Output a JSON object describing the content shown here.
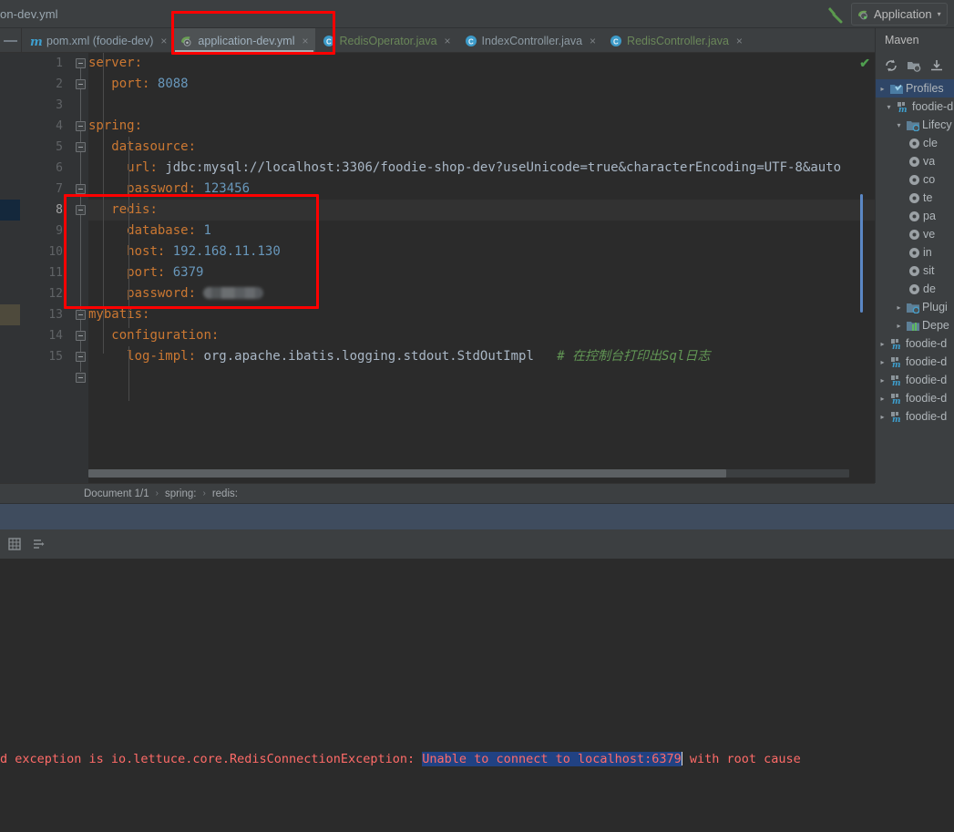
{
  "window": {
    "nav_breadcrumb": "on-dev.yml",
    "run_config": "Application",
    "run_config_arrow": "▾",
    "minimize_label": "—"
  },
  "tabs": [
    {
      "label": "pom.xml (foodie-dev)",
      "icon": "maven-m-icon",
      "close": "×",
      "active": false,
      "color": "#4f9cc4"
    },
    {
      "label": "application-dev.yml",
      "icon": "spring-leaf-icon",
      "close": "×",
      "active": true,
      "color": "#9aa7b0"
    },
    {
      "label": "RedisOperator.java",
      "icon": "java-class-icon",
      "close": "×",
      "active": false,
      "color": "#6a8759"
    },
    {
      "label": "IndexController.java",
      "icon": "java-class-icon",
      "close": "×",
      "active": false,
      "color": "#8d9aa3"
    },
    {
      "label": "RedisController.java",
      "icon": "java-class-icon",
      "close": "×",
      "active": false,
      "color": "#6a8759"
    }
  ],
  "editor": {
    "file": "application-dev.yml",
    "current_line": 8,
    "line_numbers": [
      "1",
      "2",
      "3",
      "4",
      "5",
      "6",
      "7",
      "8",
      "9",
      "10",
      "11",
      "12",
      "13",
      "14",
      "15"
    ],
    "lines": [
      {
        "n": "1",
        "indent": 0,
        "key": "server:",
        "value": "",
        "type": "key"
      },
      {
        "n": "2",
        "indent": 1,
        "key": "port:",
        "value": "8088",
        "type": "num"
      },
      {
        "n": "3",
        "indent": 0,
        "key": "",
        "value": "",
        "type": "blank"
      },
      {
        "n": "4",
        "indent": 0,
        "key": "spring:",
        "value": "",
        "type": "key"
      },
      {
        "n": "5",
        "indent": 1,
        "key": "datasource:",
        "value": "",
        "type": "key"
      },
      {
        "n": "6",
        "indent": 2,
        "key": "url:",
        "value": "jdbc:mysql://localhost:3306/foodie-shop-dev?useUnicode=true&characterEncoding=UTF-8&auto",
        "type": "str"
      },
      {
        "n": "7",
        "indent": 2,
        "key": "password:",
        "value": "123456",
        "type": "num"
      },
      {
        "n": "8",
        "indent": 1,
        "key": "redis:",
        "value": "",
        "type": "key"
      },
      {
        "n": "9",
        "indent": 2,
        "key": "database:",
        "value": "1",
        "type": "num"
      },
      {
        "n": "10",
        "indent": 2,
        "key": "host:",
        "value": "192.168.11.130",
        "type": "num"
      },
      {
        "n": "11",
        "indent": 2,
        "key": "port:",
        "value": "6379",
        "type": "num"
      },
      {
        "n": "12",
        "indent": 2,
        "key": "password:",
        "value": "",
        "type": "masked"
      },
      {
        "n": "13",
        "indent": 0,
        "key": "mybatis:",
        "value": "",
        "type": "key"
      },
      {
        "n": "14",
        "indent": 1,
        "key": "configuration:",
        "value": "",
        "type": "key"
      },
      {
        "n": "15",
        "indent": 2,
        "key": "log-impl:",
        "value": "org.apache.ibatis.logging.stdout.StdOutImpl",
        "comment": "# 在控制台打印出Sql日志",
        "type": "str"
      }
    ],
    "inspection_status": "✔"
  },
  "breadcrumb": {
    "document": "Document 1/1",
    "sep": "›",
    "path": [
      "spring:",
      "redis:"
    ]
  },
  "maven": {
    "title": "Maven",
    "toolbar": [
      "reload-icon",
      "add-folder-icon",
      "download-sources-icon"
    ],
    "tree": [
      {
        "label": "Profiles",
        "indent": 0,
        "twist": "▸",
        "icon": "profiles-folder-icon",
        "selected": true
      },
      {
        "label": "foodie-d",
        "indent": 1,
        "twist": "▾",
        "icon": "maven-module-icon",
        "selected": false
      },
      {
        "label": "Lifecy",
        "indent": 2,
        "twist": "▾",
        "icon": "lifecycle-folder-icon",
        "selected": false
      },
      {
        "label": "cle",
        "indent": 3,
        "twist": "",
        "icon": "gear-icon",
        "selected": false
      },
      {
        "label": "va",
        "indent": 3,
        "twist": "",
        "icon": "gear-icon",
        "selected": false
      },
      {
        "label": "co",
        "indent": 3,
        "twist": "",
        "icon": "gear-icon",
        "selected": false
      },
      {
        "label": "te",
        "indent": 3,
        "twist": "",
        "icon": "gear-icon",
        "selected": false
      },
      {
        "label": "pa",
        "indent": 3,
        "twist": "",
        "icon": "gear-icon",
        "selected": false
      },
      {
        "label": "ve",
        "indent": 3,
        "twist": "",
        "icon": "gear-icon",
        "selected": false
      },
      {
        "label": "in",
        "indent": 3,
        "twist": "",
        "icon": "gear-icon",
        "selected": false
      },
      {
        "label": "sit",
        "indent": 3,
        "twist": "",
        "icon": "gear-icon",
        "selected": false
      },
      {
        "label": "de",
        "indent": 3,
        "twist": "",
        "icon": "gear-icon",
        "selected": false
      },
      {
        "label": "Plugi",
        "indent": 2,
        "twist": "▸",
        "icon": "plugins-folder-icon",
        "selected": false
      },
      {
        "label": "Depe",
        "indent": 2,
        "twist": "▸",
        "icon": "dependencies-icon",
        "selected": false
      },
      {
        "label": "foodie-d",
        "indent": 1,
        "twist": "▸",
        "icon": "maven-module-icon",
        "selected": false
      },
      {
        "label": "foodie-d",
        "indent": 1,
        "twist": "▸",
        "icon": "maven-module-icon",
        "selected": false
      },
      {
        "label": "foodie-d",
        "indent": 1,
        "twist": "▸",
        "icon": "maven-module-icon",
        "selected": false
      },
      {
        "label": "foodie-d",
        "indent": 1,
        "twist": "▸",
        "icon": "maven-module-icon",
        "selected": false
      },
      {
        "label": "foodie-d",
        "indent": 1,
        "twist": "▸",
        "icon": "maven-module-icon",
        "selected": false
      }
    ]
  },
  "console": {
    "toolbar": [
      "soft-wrap-icon",
      "scroll-to-end-icon"
    ],
    "error_prefix": "d exception is io.lettuce.core.RedisConnectionException: ",
    "error_selected": "Unable to connect to localhost:6379",
    "error_suffix": " with root cause"
  },
  "annotations": {
    "tab_highlight": "red-rect-active-tab",
    "redis_block_highlight": "red-rect-redis-block",
    "accent_red": "#ff0000",
    "selection_blue": "#214283"
  }
}
